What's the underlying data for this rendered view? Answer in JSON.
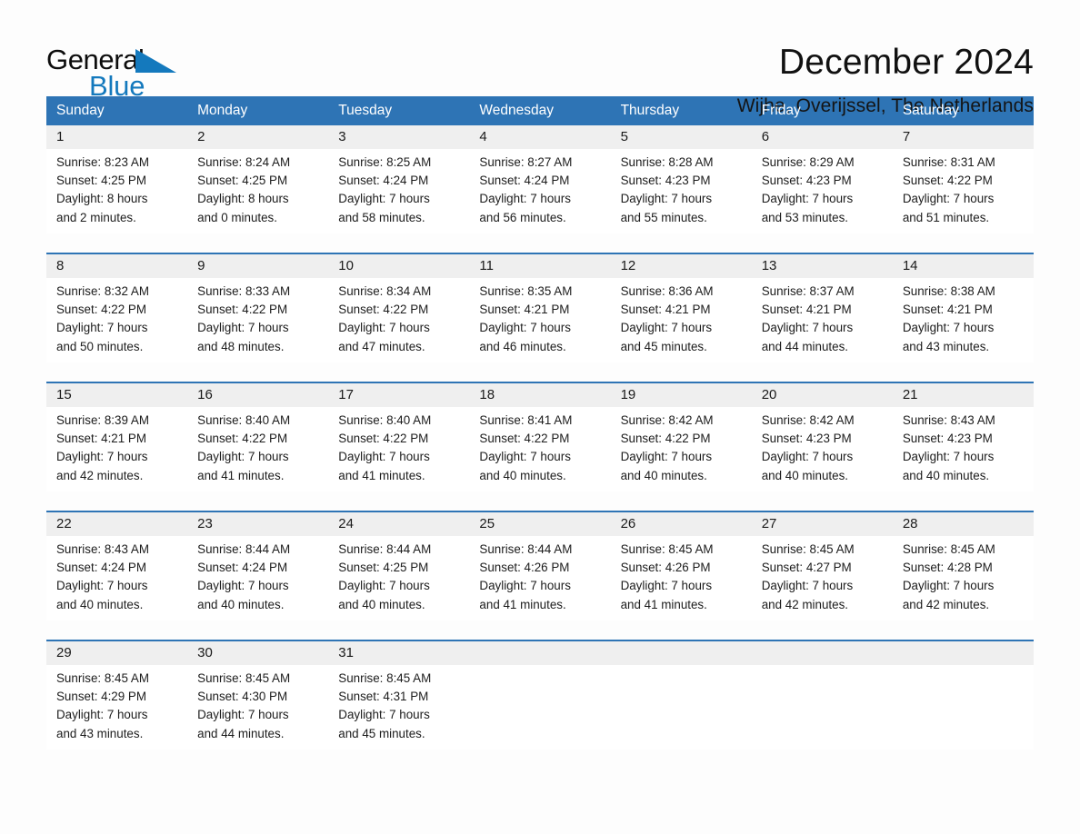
{
  "brand": {
    "name_part1": "General",
    "name_part2": "Blue",
    "triangle_icon": "blue-triangle-logo-mark",
    "accent_color": "#1479bd"
  },
  "header": {
    "title": "December 2024",
    "location": "Wijhe, Overijssel, The Netherlands"
  },
  "theme": {
    "header_blue": "#2e74b5",
    "day_band_gray": "#efefef",
    "text_color": "#1a1a1a"
  },
  "calendar": {
    "weekdays": [
      "Sunday",
      "Monday",
      "Tuesday",
      "Wednesday",
      "Thursday",
      "Friday",
      "Saturday"
    ],
    "weeks": [
      [
        {
          "day": "1",
          "sunrise": "Sunrise: 8:23 AM",
          "sunset": "Sunset: 4:25 PM",
          "daylight_line1": "Daylight: 8 hours",
          "daylight_line2": "and 2 minutes."
        },
        {
          "day": "2",
          "sunrise": "Sunrise: 8:24 AM",
          "sunset": "Sunset: 4:25 PM",
          "daylight_line1": "Daylight: 8 hours",
          "daylight_line2": "and 0 minutes."
        },
        {
          "day": "3",
          "sunrise": "Sunrise: 8:25 AM",
          "sunset": "Sunset: 4:24 PM",
          "daylight_line1": "Daylight: 7 hours",
          "daylight_line2": "and 58 minutes."
        },
        {
          "day": "4",
          "sunrise": "Sunrise: 8:27 AM",
          "sunset": "Sunset: 4:24 PM",
          "daylight_line1": "Daylight: 7 hours",
          "daylight_line2": "and 56 minutes."
        },
        {
          "day": "5",
          "sunrise": "Sunrise: 8:28 AM",
          "sunset": "Sunset: 4:23 PM",
          "daylight_line1": "Daylight: 7 hours",
          "daylight_line2": "and 55 minutes."
        },
        {
          "day": "6",
          "sunrise": "Sunrise: 8:29 AM",
          "sunset": "Sunset: 4:23 PM",
          "daylight_line1": "Daylight: 7 hours",
          "daylight_line2": "and 53 minutes."
        },
        {
          "day": "7",
          "sunrise": "Sunrise: 8:31 AM",
          "sunset": "Sunset: 4:22 PM",
          "daylight_line1": "Daylight: 7 hours",
          "daylight_line2": "and 51 minutes."
        }
      ],
      [
        {
          "day": "8",
          "sunrise": "Sunrise: 8:32 AM",
          "sunset": "Sunset: 4:22 PM",
          "daylight_line1": "Daylight: 7 hours",
          "daylight_line2": "and 50 minutes."
        },
        {
          "day": "9",
          "sunrise": "Sunrise: 8:33 AM",
          "sunset": "Sunset: 4:22 PM",
          "daylight_line1": "Daylight: 7 hours",
          "daylight_line2": "and 48 minutes."
        },
        {
          "day": "10",
          "sunrise": "Sunrise: 8:34 AM",
          "sunset": "Sunset: 4:22 PM",
          "daylight_line1": "Daylight: 7 hours",
          "daylight_line2": "and 47 minutes."
        },
        {
          "day": "11",
          "sunrise": "Sunrise: 8:35 AM",
          "sunset": "Sunset: 4:21 PM",
          "daylight_line1": "Daylight: 7 hours",
          "daylight_line2": "and 46 minutes."
        },
        {
          "day": "12",
          "sunrise": "Sunrise: 8:36 AM",
          "sunset": "Sunset: 4:21 PM",
          "daylight_line1": "Daylight: 7 hours",
          "daylight_line2": "and 45 minutes."
        },
        {
          "day": "13",
          "sunrise": "Sunrise: 8:37 AM",
          "sunset": "Sunset: 4:21 PM",
          "daylight_line1": "Daylight: 7 hours",
          "daylight_line2": "and 44 minutes."
        },
        {
          "day": "14",
          "sunrise": "Sunrise: 8:38 AM",
          "sunset": "Sunset: 4:21 PM",
          "daylight_line1": "Daylight: 7 hours",
          "daylight_line2": "and 43 minutes."
        }
      ],
      [
        {
          "day": "15",
          "sunrise": "Sunrise: 8:39 AM",
          "sunset": "Sunset: 4:21 PM",
          "daylight_line1": "Daylight: 7 hours",
          "daylight_line2": "and 42 minutes."
        },
        {
          "day": "16",
          "sunrise": "Sunrise: 8:40 AM",
          "sunset": "Sunset: 4:22 PM",
          "daylight_line1": "Daylight: 7 hours",
          "daylight_line2": "and 41 minutes."
        },
        {
          "day": "17",
          "sunrise": "Sunrise: 8:40 AM",
          "sunset": "Sunset: 4:22 PM",
          "daylight_line1": "Daylight: 7 hours",
          "daylight_line2": "and 41 minutes."
        },
        {
          "day": "18",
          "sunrise": "Sunrise: 8:41 AM",
          "sunset": "Sunset: 4:22 PM",
          "daylight_line1": "Daylight: 7 hours",
          "daylight_line2": "and 40 minutes."
        },
        {
          "day": "19",
          "sunrise": "Sunrise: 8:42 AM",
          "sunset": "Sunset: 4:22 PM",
          "daylight_line1": "Daylight: 7 hours",
          "daylight_line2": "and 40 minutes."
        },
        {
          "day": "20",
          "sunrise": "Sunrise: 8:42 AM",
          "sunset": "Sunset: 4:23 PM",
          "daylight_line1": "Daylight: 7 hours",
          "daylight_line2": "and 40 minutes."
        },
        {
          "day": "21",
          "sunrise": "Sunrise: 8:43 AM",
          "sunset": "Sunset: 4:23 PM",
          "daylight_line1": "Daylight: 7 hours",
          "daylight_line2": "and 40 minutes."
        }
      ],
      [
        {
          "day": "22",
          "sunrise": "Sunrise: 8:43 AM",
          "sunset": "Sunset: 4:24 PM",
          "daylight_line1": "Daylight: 7 hours",
          "daylight_line2": "and 40 minutes."
        },
        {
          "day": "23",
          "sunrise": "Sunrise: 8:44 AM",
          "sunset": "Sunset: 4:24 PM",
          "daylight_line1": "Daylight: 7 hours",
          "daylight_line2": "and 40 minutes."
        },
        {
          "day": "24",
          "sunrise": "Sunrise: 8:44 AM",
          "sunset": "Sunset: 4:25 PM",
          "daylight_line1": "Daylight: 7 hours",
          "daylight_line2": "and 40 minutes."
        },
        {
          "day": "25",
          "sunrise": "Sunrise: 8:44 AM",
          "sunset": "Sunset: 4:26 PM",
          "daylight_line1": "Daylight: 7 hours",
          "daylight_line2": "and 41 minutes."
        },
        {
          "day": "26",
          "sunrise": "Sunrise: 8:45 AM",
          "sunset": "Sunset: 4:26 PM",
          "daylight_line1": "Daylight: 7 hours",
          "daylight_line2": "and 41 minutes."
        },
        {
          "day": "27",
          "sunrise": "Sunrise: 8:45 AM",
          "sunset": "Sunset: 4:27 PM",
          "daylight_line1": "Daylight: 7 hours",
          "daylight_line2": "and 42 minutes."
        },
        {
          "day": "28",
          "sunrise": "Sunrise: 8:45 AM",
          "sunset": "Sunset: 4:28 PM",
          "daylight_line1": "Daylight: 7 hours",
          "daylight_line2": "and 42 minutes."
        }
      ],
      [
        {
          "day": "29",
          "sunrise": "Sunrise: 8:45 AM",
          "sunset": "Sunset: 4:29 PM",
          "daylight_line1": "Daylight: 7 hours",
          "daylight_line2": "and 43 minutes."
        },
        {
          "day": "30",
          "sunrise": "Sunrise: 8:45 AM",
          "sunset": "Sunset: 4:30 PM",
          "daylight_line1": "Daylight: 7 hours",
          "daylight_line2": "and 44 minutes."
        },
        {
          "day": "31",
          "sunrise": "Sunrise: 8:45 AM",
          "sunset": "Sunset: 4:31 PM",
          "daylight_line1": "Daylight: 7 hours",
          "daylight_line2": "and 45 minutes."
        },
        {
          "day": "",
          "sunrise": "",
          "sunset": "",
          "daylight_line1": "",
          "daylight_line2": ""
        },
        {
          "day": "",
          "sunrise": "",
          "sunset": "",
          "daylight_line1": "",
          "daylight_line2": ""
        },
        {
          "day": "",
          "sunrise": "",
          "sunset": "",
          "daylight_line1": "",
          "daylight_line2": ""
        },
        {
          "day": "",
          "sunrise": "",
          "sunset": "",
          "daylight_line1": "",
          "daylight_line2": ""
        }
      ]
    ]
  }
}
